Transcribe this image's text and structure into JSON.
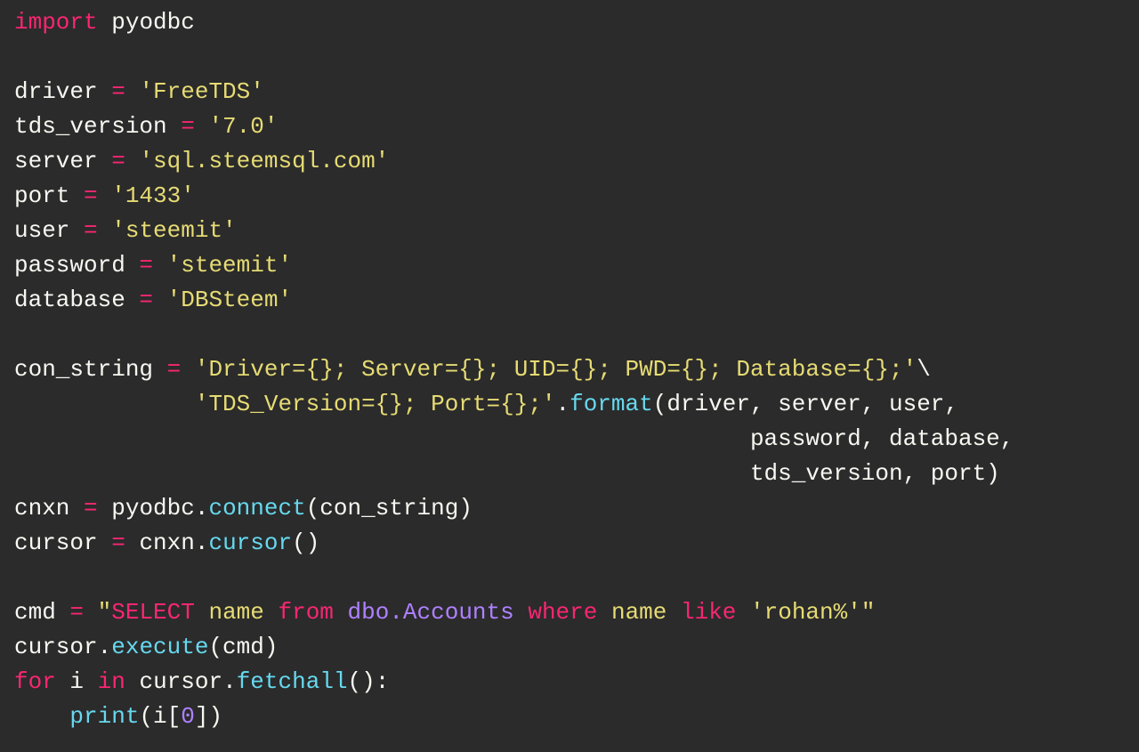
{
  "code": {
    "l1_import": "import",
    "l1_module": "pyodbc",
    "l3_driver": "driver",
    "l3_val": "'FreeTDS'",
    "l4_tds": "tds_version",
    "l4_val": "'7.0'",
    "l5_server": "server",
    "l5_val": "'sql.steemsql.com'",
    "l6_port": "port",
    "l6_val": "'1433'",
    "l7_user": "user",
    "l7_val": "'steemit'",
    "l8_password": "password",
    "l8_val": "'steemit'",
    "l9_database": "database",
    "l9_val": "'DBSteem'",
    "l11_con": "con_string",
    "l11_s1": "'Driver={}; Server={}; UID={}; PWD={}; Database={};'",
    "l12_s2": "'TDS_Version={}; Port={};'",
    "l12_format": "format",
    "l12_args1": "(driver, server, user,",
    "l13_args2": "password, database,",
    "l14_args3": "tds_version, port)",
    "l15_cnxn": "cnxn",
    "l15_pyodbc": "pyodbc",
    "l15_connect": "connect",
    "l15_args": "(con_string)",
    "l16_cursor": "cursor",
    "l16_cnxn": "cnxn",
    "l16_method": "cursor",
    "l16_paren": "()",
    "l18_cmd": "cmd",
    "l18_q1": "\"",
    "l18_sql_select": "SELECT",
    "l18_sql_name1": " name ",
    "l18_sql_from": "from",
    "l18_sql_tbl": " dbo.Accounts ",
    "l18_sql_where": "where",
    "l18_sql_name2": " name ",
    "l18_sql_like": "like",
    "l18_sql_lit": " 'rohan%'",
    "l18_q2": "\"",
    "l19_cursor": "cursor",
    "l19_execute": "execute",
    "l19_args": "(cmd)",
    "l20_for": "for",
    "l20_i": "i",
    "l20_in": "in",
    "l20_cursor": "cursor",
    "l20_fetchall": "fetchall",
    "l20_paren": "():",
    "l21_print": "print",
    "l21_open": "(i[",
    "l21_zero": "0",
    "l21_close": "])",
    "eq": " = ",
    "dot": ".",
    "bslash": "\\"
  }
}
